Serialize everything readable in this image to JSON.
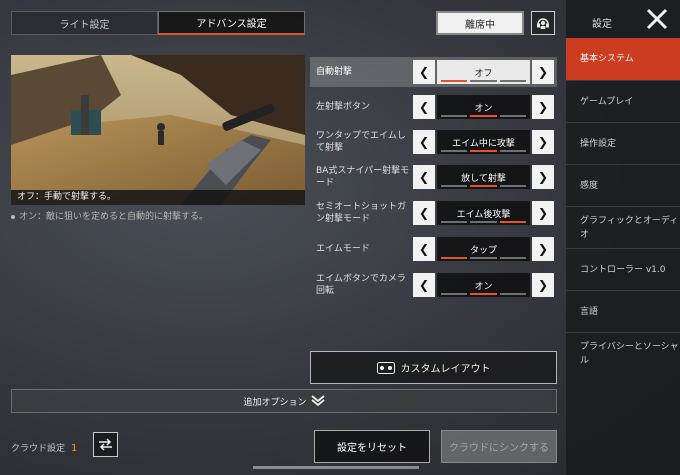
{
  "tabs": {
    "lite": "ライト設定",
    "advanced": "アドバンス設定"
  },
  "header": {
    "away_label": "離席中",
    "headset_icon": "headset-icon"
  },
  "preview": {
    "caption": "オフ：手動で射撃する。",
    "description": "オン：敵に狙いを定めると自動的に射撃する。"
  },
  "settings": [
    {
      "label": "自動射撃",
      "value": "オフ",
      "segments": [
        true,
        false,
        false
      ]
    },
    {
      "label": "左射撃ボタン",
      "value": "オン",
      "segments": [
        false,
        true,
        false
      ]
    },
    {
      "label": "ワンタップでエイムして射撃",
      "value": "エイム中に攻撃",
      "segments": [
        false,
        true,
        false
      ]
    },
    {
      "label": "BA式スナイパー射撃モード",
      "value": "放して射撃",
      "segments": [
        false,
        true,
        false
      ]
    },
    {
      "label": "セミオートショットガン射撃モード",
      "value": "エイム後攻撃",
      "segments": [
        false,
        false,
        true
      ]
    },
    {
      "label": "エイムモード",
      "value": "タップ",
      "segments": [
        true,
        false,
        false
      ]
    },
    {
      "label": "エイムボタンでカメラ回転",
      "value": "オン",
      "segments": [
        false,
        true,
        false
      ]
    }
  ],
  "custom_layout_label": "カスタムレイアウト",
  "extra_options_label": "追加オプション",
  "cloud": {
    "label": "クラウド設定",
    "count": "1"
  },
  "buttons": {
    "reset": "設定をリセット",
    "sync": "クラウドにシンクする"
  },
  "sidebar": {
    "title": "設定",
    "items": [
      "基本システム",
      "ゲームプレイ",
      "操作設定",
      "感度",
      "グラフィックとオーディオ",
      "コントローラー v1.0",
      "言語",
      "プライバシーとソーシャル"
    ]
  },
  "colors": {
    "accent": "#e5532c",
    "active_sidebar": "#cc3c21",
    "cloud_count": "#e5a02c"
  }
}
